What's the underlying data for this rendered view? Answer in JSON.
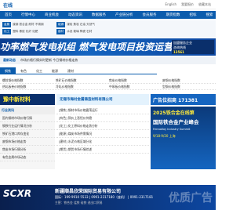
{
  "header": {
    "logo": "在线",
    "top_links": [
      "English",
      "我要报价",
      "收藏本站"
    ]
  },
  "nav": {
    "items": [
      "首页",
      "行情中心",
      "商业机会",
      "动态资讯",
      "数据服务",
      "产业链分析",
      "会员服务",
      "期货指数",
      "招标",
      "搜索"
    ]
  },
  "subnav": {
    "groups": [
      {
        "tag": "金属",
        "text": "废钢 铁合金 耐材 不锈钢"
      },
      {
        "tag": "能源",
        "text": "煤炭 焦炭 石油 天然气"
      },
      {
        "tag": "化工",
        "text": "塑料 橡胶 化纤 化肥"
      },
      {
        "tag": "建材",
        "text": "水泥 玻璃 陶瓷 石材"
      }
    ]
  },
  "banner": {
    "headline": "功率燃气发电机组 燃气发电项目投资运营",
    "side_line1": "加盟服务企业",
    "side_line2": "咨询热线",
    "side_phone": "13561"
  },
  "infobar": {
    "label": "最新动态",
    "text": "市场价格行情实时更新 今日钢材价格走势"
  },
  "tabs": {
    "items": [
      "钢铁",
      "有色",
      "化工",
      "能源",
      "建材"
    ],
    "active": 0
  },
  "prices": {
    "rows": [
      [
        "螺纹钢价格指数",
        "铁矿石价格指数",
        "焦炭价格指数",
        "废钢价格指数"
      ],
      [
        "热轧板卷价格指数",
        "冷轧价格指数",
        "中厚板价格指数",
        "型钢价格指数"
      ]
    ]
  },
  "ads": {
    "left": "豫中新材料",
    "mid": "无锡市梅村金属铸造材料有限公司",
    "right": "广告位招商 171381"
  },
  "leftcol": {
    "heading": "行业资讯",
    "items": [
      "国内钢材市场价格行情",
      "钢铁行业运行情况分析",
      "铁矿石港口库存变化",
      "废钢市场价格走势",
      "焦炭市场行情分析",
      "有色金属市场动态"
    ]
  },
  "midcol": {
    "items": [
      "[钢铁] 钢材市场价格震荡运行",
      "[有色] 铜价上涨铝价持稳",
      "[化工] 化工原料价格走势分析",
      "[能源] 煤炭市场供需情况",
      "[建材] 水泥价格区域分化",
      "[期货] 期货市场行情综述"
    ]
  },
  "rightad": {
    "line1": "2025铁合金在线第",
    "line2": "国际铁合金产业峰会",
    "line3": "Ferroalloy Industry Summit",
    "line4": "9/18-9/20 上海"
  },
  "footer": {
    "brand": "SCXR",
    "company": "新疆顺昌欣荣国际贸易有限公司",
    "phone": "国际：199 9910 5533 | 0991-2317180（座机） | 0991-2317181",
    "note": "主营：铁合金 锰铁 硅铁 进出口贸易",
    "watermark": "优质广告"
  }
}
